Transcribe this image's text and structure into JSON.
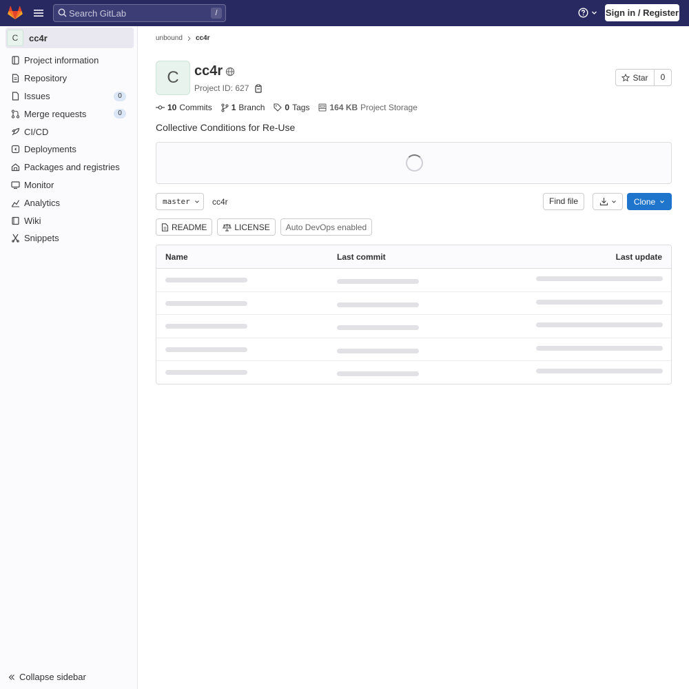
{
  "topbar": {
    "search_placeholder": "Search GitLab",
    "search_shortcut": "/",
    "signin_label": "Sign in / Register"
  },
  "sidebar": {
    "project_avatar_letter": "C",
    "project_name": "cc4r",
    "items": [
      {
        "label": "Project information",
        "icon": "info-icon"
      },
      {
        "label": "Repository",
        "icon": "doc-icon"
      },
      {
        "label": "Issues",
        "icon": "issues-icon",
        "badge": "0"
      },
      {
        "label": "Merge requests",
        "icon": "merge-request-icon",
        "badge": "0"
      },
      {
        "label": "CI/CD",
        "icon": "rocket-icon"
      },
      {
        "label": "Deployments",
        "icon": "deployments-icon"
      },
      {
        "label": "Packages and registries",
        "icon": "package-icon"
      },
      {
        "label": "Monitor",
        "icon": "monitor-icon"
      },
      {
        "label": "Analytics",
        "icon": "chart-icon"
      },
      {
        "label": "Wiki",
        "icon": "book-icon"
      },
      {
        "label": "Snippets",
        "icon": "snippet-icon"
      }
    ],
    "collapse_label": "Collapse sidebar"
  },
  "breadcrumb": {
    "parent": "unbound",
    "current": "cc4r"
  },
  "project": {
    "avatar_letter": "C",
    "title": "cc4r",
    "id_label": "Project ID: 627",
    "star_label": "Star",
    "star_count": "0",
    "description": "Collective Conditions for Re-Use"
  },
  "stats": {
    "commits_count": "10",
    "commits_label": "Commits",
    "branch_count": "1",
    "branch_label": "Branch",
    "tags_count": "0",
    "tags_label": "Tags",
    "storage_size": "164 KB",
    "storage_label": "Project Storage"
  },
  "repo": {
    "branch": "master",
    "path": "cc4r",
    "find_file_label": "Find file",
    "clone_label": "Clone",
    "readme_label": "README",
    "license_label": "LICENSE",
    "devops_label": "Auto DevOps enabled"
  },
  "table": {
    "col_name": "Name",
    "col_commit": "Last commit",
    "col_update": "Last update",
    "placeholder_rows": 5
  },
  "colors": {
    "topbar": "#292961",
    "accent": "#1f75cb"
  }
}
